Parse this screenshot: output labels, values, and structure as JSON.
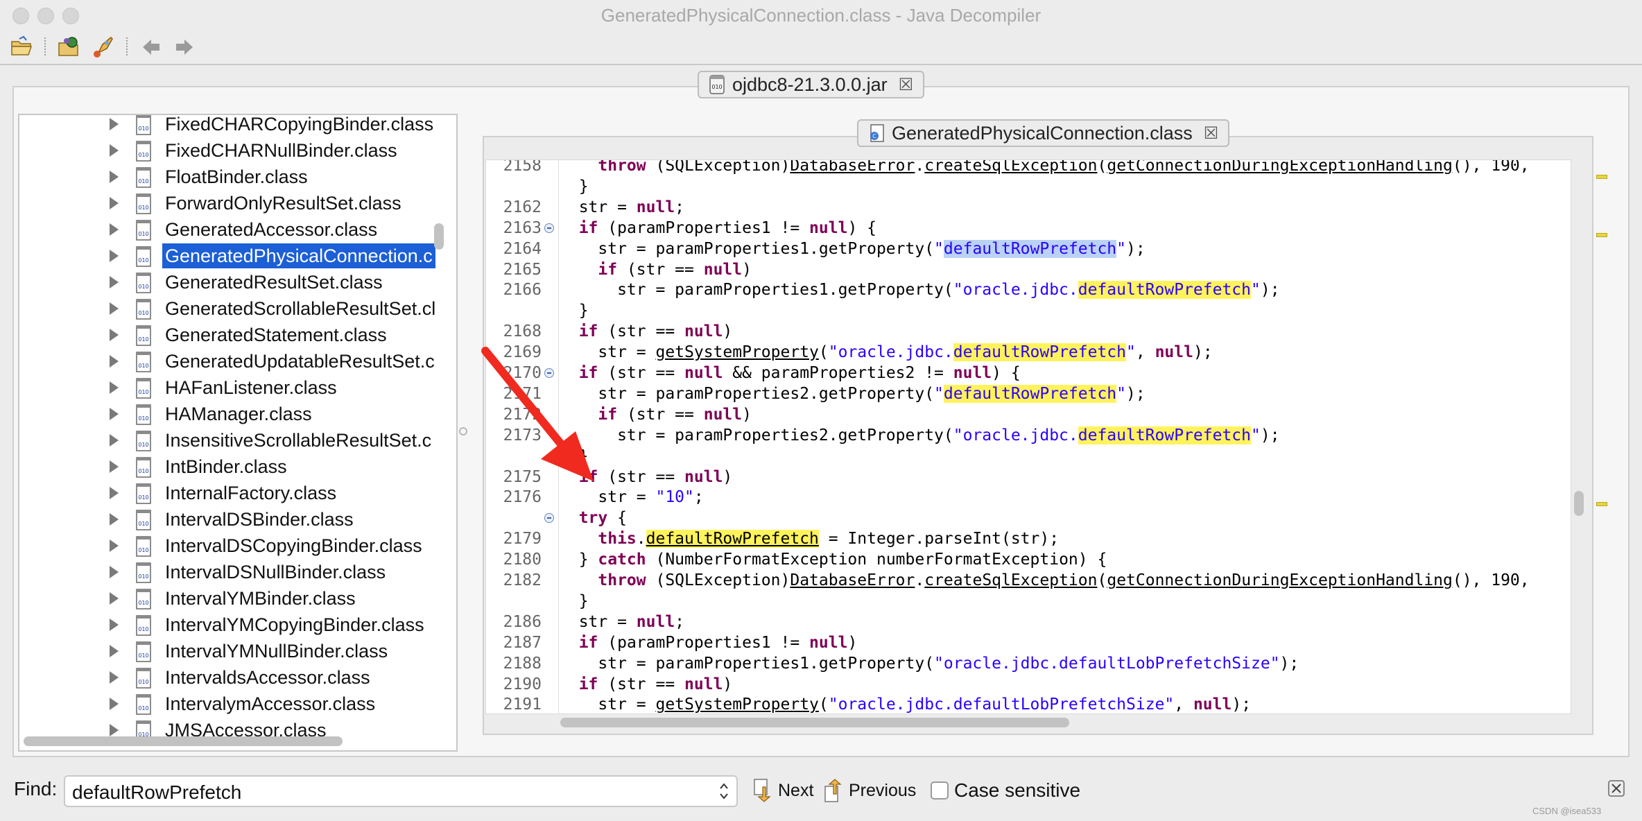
{
  "window": {
    "title": "GeneratedPhysicalConnection.class - Java Decompiler"
  },
  "toolbar": {
    "buttons": [
      "open-folder-icon",
      "open-type-icon",
      "search-rocket-icon",
      "back-arrow-icon",
      "forward-arrow-icon"
    ]
  },
  "jar_tab": {
    "label": "ojdbc8-21.3.0.0.jar",
    "icon_text": "010"
  },
  "tree": {
    "items": [
      "FixedCHARCopyingBinder.class",
      "FixedCHARNullBinder.class",
      "FloatBinder.class",
      "ForwardOnlyResultSet.class",
      "GeneratedAccessor.class",
      "GeneratedPhysicalConnection.c",
      "GeneratedResultSet.class",
      "GeneratedScrollableResultSet.cl",
      "GeneratedStatement.class",
      "GeneratedUpdatableResultSet.c",
      "HAFanListener.class",
      "HAManager.class",
      "InsensitiveScrollableResultSet.c",
      "IntBinder.class",
      "InternalFactory.class",
      "IntervalDSBinder.class",
      "IntervalDSCopyingBinder.class",
      "IntervalDSNullBinder.class",
      "IntervalYMBinder.class",
      "IntervalYMCopyingBinder.class",
      "IntervalYMNullBinder.class",
      "IntervaldsAccessor.class",
      "IntervalymAccessor.class",
      "JMSAccessor.class"
    ],
    "selected_index": 5
  },
  "editor_tab": {
    "label": "GeneratedPhysicalConnection.class"
  },
  "code": {
    "lines": [
      {
        "n": "2158",
        "fold": false,
        "tokens": [
          [
            "kw",
            "    throw "
          ],
          [
            "p",
            "(SQLException)"
          ],
          [
            "mth",
            "DatabaseError"
          ],
          [
            "p",
            "."
          ],
          [
            "mth",
            "createSqlException"
          ],
          [
            "p",
            "("
          ],
          [
            "mth",
            "getConnectionDuringExceptionHandling"
          ],
          [
            "p",
            "(), 190,"
          ]
        ]
      },
      {
        "n": "",
        "fold": false,
        "tokens": [
          [
            "p",
            "  }"
          ]
        ]
      },
      {
        "n": "2162",
        "fold": false,
        "tokens": [
          [
            "p",
            "  str = "
          ],
          [
            "kw",
            "null"
          ],
          [
            "p",
            ";"
          ]
        ]
      },
      {
        "n": "2163",
        "fold": true,
        "tokens": [
          [
            "kw",
            "  if "
          ],
          [
            "p",
            "(paramProperties1 != "
          ],
          [
            "kw",
            "null"
          ],
          [
            "p",
            ") {"
          ]
        ]
      },
      {
        "n": "2164",
        "fold": false,
        "tokens": [
          [
            "p",
            "    str = paramProperties1.getProperty("
          ],
          [
            "str",
            "\""
          ],
          [
            "strb",
            "defaultRowPrefetch"
          ],
          [
            "str",
            "\""
          ],
          [
            "p",
            ");"
          ]
        ]
      },
      {
        "n": "2165",
        "fold": false,
        "tokens": [
          [
            "kw",
            "    if "
          ],
          [
            "p",
            "(str == "
          ],
          [
            "kw",
            "null"
          ],
          [
            "p",
            ")"
          ]
        ]
      },
      {
        "n": "2166",
        "fold": false,
        "tokens": [
          [
            "p",
            "      str = paramProperties1.getProperty("
          ],
          [
            "str",
            "\"oracle.jdbc."
          ],
          [
            "stry",
            "defaultRowPrefetch"
          ],
          [
            "str",
            "\""
          ],
          [
            "p",
            ");"
          ]
        ]
      },
      {
        "n": "",
        "fold": false,
        "tokens": [
          [
            "p",
            "  }"
          ]
        ]
      },
      {
        "n": "2168",
        "fold": false,
        "tokens": [
          [
            "kw",
            "  if "
          ],
          [
            "p",
            "(str == "
          ],
          [
            "kw",
            "null"
          ],
          [
            "p",
            ")"
          ]
        ]
      },
      {
        "n": "2169",
        "fold": false,
        "tokens": [
          [
            "p",
            "    str = "
          ],
          [
            "mth",
            "getSystemProperty"
          ],
          [
            "p",
            "("
          ],
          [
            "str",
            "\"oracle.jdbc."
          ],
          [
            "stry",
            "defaultRowPrefetch"
          ],
          [
            "str",
            "\""
          ],
          [
            "p",
            ", "
          ],
          [
            "kw",
            "null"
          ],
          [
            "p",
            ");"
          ]
        ]
      },
      {
        "n": "2170",
        "fold": true,
        "tokens": [
          [
            "kw",
            "  if "
          ],
          [
            "p",
            "(str == "
          ],
          [
            "kw",
            "null"
          ],
          [
            "p",
            " && paramProperties2 != "
          ],
          [
            "kw",
            "null"
          ],
          [
            "p",
            ") {"
          ]
        ]
      },
      {
        "n": "2171",
        "fold": false,
        "tokens": [
          [
            "p",
            "    str = paramProperties2.getProperty("
          ],
          [
            "str",
            "\""
          ],
          [
            "stry",
            "defaultRowPrefetch"
          ],
          [
            "str",
            "\""
          ],
          [
            "p",
            ");"
          ]
        ]
      },
      {
        "n": "2172",
        "fold": false,
        "tokens": [
          [
            "kw",
            "    if "
          ],
          [
            "p",
            "(str == "
          ],
          [
            "kw",
            "null"
          ],
          [
            "p",
            ")"
          ]
        ]
      },
      {
        "n": "2173",
        "fold": false,
        "tokens": [
          [
            "p",
            "      str = paramProperties2.getProperty("
          ],
          [
            "str",
            "\"oracle.jdbc."
          ],
          [
            "stry",
            "defaultRowPrefetch"
          ],
          [
            "str",
            "\""
          ],
          [
            "p",
            ");"
          ]
        ]
      },
      {
        "n": "",
        "fold": false,
        "tokens": [
          [
            "p",
            "  }"
          ]
        ]
      },
      {
        "n": "2175",
        "fold": false,
        "tokens": [
          [
            "kw",
            "  if "
          ],
          [
            "p",
            "(str == "
          ],
          [
            "kw",
            "null"
          ],
          [
            "p",
            ")"
          ]
        ]
      },
      {
        "n": "2176",
        "fold": false,
        "tokens": [
          [
            "p",
            "    str = "
          ],
          [
            "str",
            "\"10\""
          ],
          [
            "p",
            ";"
          ]
        ]
      },
      {
        "n": "",
        "fold": true,
        "tokens": [
          [
            "kw",
            "  try "
          ],
          [
            "p",
            "{"
          ]
        ]
      },
      {
        "n": "2179",
        "fold": false,
        "tokens": [
          [
            "kw",
            "    this"
          ],
          [
            "p",
            "."
          ],
          [
            "fld",
            "defaultRowPrefetch"
          ],
          [
            "p",
            " = Integer.parseInt(str);"
          ]
        ]
      },
      {
        "n": "2180",
        "fold": false,
        "tokens": [
          [
            "p",
            "  } "
          ],
          [
            "kw",
            "catch "
          ],
          [
            "p",
            "(NumberFormatException numberFormatException) {"
          ]
        ]
      },
      {
        "n": "2182",
        "fold": false,
        "tokens": [
          [
            "kw",
            "    throw "
          ],
          [
            "p",
            "(SQLException)"
          ],
          [
            "mth",
            "DatabaseError"
          ],
          [
            "p",
            "."
          ],
          [
            "mth",
            "createSqlException"
          ],
          [
            "p",
            "("
          ],
          [
            "mth",
            "getConnectionDuringExceptionHandling"
          ],
          [
            "p",
            "(), 190,"
          ]
        ]
      },
      {
        "n": "",
        "fold": false,
        "tokens": [
          [
            "p",
            "  }"
          ]
        ]
      },
      {
        "n": "2186",
        "fold": false,
        "tokens": [
          [
            "p",
            "  str = "
          ],
          [
            "kw",
            "null"
          ],
          [
            "p",
            ";"
          ]
        ]
      },
      {
        "n": "2187",
        "fold": false,
        "tokens": [
          [
            "kw",
            "  if "
          ],
          [
            "p",
            "(paramProperties1 != "
          ],
          [
            "kw",
            "null"
          ],
          [
            "p",
            ")"
          ]
        ]
      },
      {
        "n": "2188",
        "fold": false,
        "tokens": [
          [
            "p",
            "    str = paramProperties1.getProperty("
          ],
          [
            "str",
            "\"oracle.jdbc.defaultLobPrefetchSize\""
          ],
          [
            "p",
            ");"
          ]
        ]
      },
      {
        "n": "2190",
        "fold": false,
        "tokens": [
          [
            "kw",
            "  if "
          ],
          [
            "p",
            "(str == "
          ],
          [
            "kw",
            "null"
          ],
          [
            "p",
            ")"
          ]
        ]
      },
      {
        "n": "2191",
        "fold": false,
        "tokens": [
          [
            "p",
            "    str = "
          ],
          [
            "mth",
            "getSystemProperty"
          ],
          [
            "p",
            "("
          ],
          [
            "str",
            "\"oracle.jdbc.defaultLobPrefetchSize\""
          ],
          [
            "p",
            ", "
          ],
          [
            "kw",
            "null"
          ],
          [
            "p",
            ");"
          ]
        ]
      }
    ]
  },
  "find": {
    "label": "Find:",
    "value": "defaultRowPrefetch",
    "next_label": "Next",
    "previous_label": "Previous",
    "case_label": "Case sensitive"
  },
  "watermark": "CSDN @isea533",
  "colors": {
    "selection": "#1c5fd6",
    "keyword": "#7f0055",
    "string": "#2a00ff",
    "highlight": "#fff35c",
    "arrow": "#f02a1f"
  }
}
